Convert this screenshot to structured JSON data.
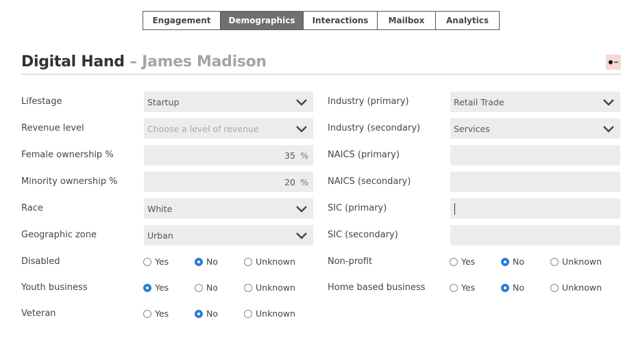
{
  "tabs": [
    {
      "label": "Engagement",
      "active": false
    },
    {
      "label": "Demographics",
      "active": true
    },
    {
      "label": "Interactions",
      "active": false
    },
    {
      "label": "Mailbox",
      "active": false
    },
    {
      "label": "Analytics",
      "active": false
    }
  ],
  "header": {
    "company": "Digital Hand",
    "separator": " – ",
    "contact": "James Madison"
  },
  "left": {
    "lifestage": {
      "label": "Lifestage",
      "value": "Startup"
    },
    "revenue": {
      "label": "Revenue level",
      "placeholder": "Choose a level of revenue"
    },
    "female": {
      "label": "Female ownership %",
      "value": "35",
      "unit": "%"
    },
    "minority": {
      "label": "Minority ownership %",
      "value": "20",
      "unit": "%"
    },
    "race": {
      "label": "Race",
      "value": "White"
    },
    "geo": {
      "label": "Geographic zone",
      "value": "Urban"
    },
    "disabled": {
      "label": "Disabled",
      "selected": "No"
    },
    "youth": {
      "label": "Youth business",
      "selected": "Yes"
    },
    "veteran": {
      "label": "Veteran",
      "selected": "No"
    }
  },
  "right": {
    "ind1": {
      "label": "Industry (primary)",
      "value": "Retail Trade"
    },
    "ind2": {
      "label": "Industry (secondary)",
      "value": "Services"
    },
    "naics1": {
      "label": "NAICS (primary)",
      "value": ""
    },
    "naics2": {
      "label": "NAICS (secondary)",
      "value": ""
    },
    "sic1": {
      "label": "SIC (primary)",
      "value": ""
    },
    "sic2": {
      "label": "SIC (secondary)",
      "value": ""
    },
    "nonprofit": {
      "label": "Non-profit",
      "selected": "No"
    },
    "home": {
      "label": "Home based business",
      "selected": "No"
    }
  },
  "radio_options": {
    "yes": "Yes",
    "no": "No",
    "unknown": "Unknown"
  },
  "colors": {
    "active_tab": "#707070",
    "radio_selected": "#2b7bd8",
    "field_bg": "#ececec"
  }
}
